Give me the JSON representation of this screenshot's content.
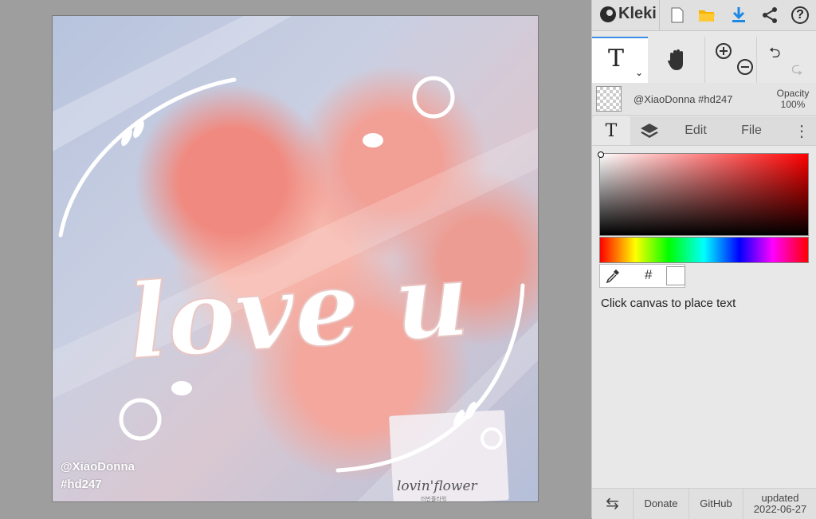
{
  "app": {
    "name": "Kleki"
  },
  "canvas": {
    "watermark_line1": "@XiaoDonna",
    "watermark_line2": "#hd247",
    "artwork_text": "love u",
    "card_text": "lovin'flower",
    "card_subtext": "러빈플라워"
  },
  "topbar": {
    "icons": [
      "new-image-icon",
      "open-folder-icon",
      "download-icon",
      "share-icon",
      "help-icon"
    ],
    "help_symbol": "?"
  },
  "tools": {
    "active": "text",
    "text_symbol": "T",
    "caret": "⌄",
    "undo_symbol": "⮌",
    "redo_symbol": "⮎"
  },
  "layer": {
    "name": "@XiaoDonna #hd247",
    "opacity_label": "Opacity",
    "opacity_value": "100%"
  },
  "tabs": {
    "text_tab": "T",
    "edit": "Edit",
    "file": "File",
    "more": "⋮"
  },
  "color": {
    "hex_symbol": "#",
    "selected_color": "#ffffff",
    "hint": "Click canvas to place text"
  },
  "footer": {
    "swap_symbol": "⇆",
    "donate": "Donate",
    "github": "GitHub",
    "updated_label": "updated",
    "updated_date": "2022-06-27"
  }
}
